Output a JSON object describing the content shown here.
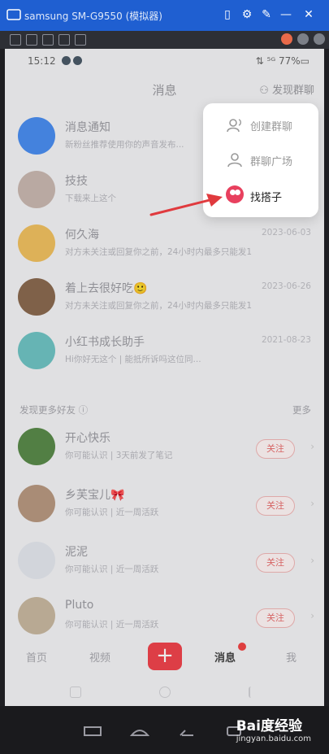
{
  "window": {
    "title": "samsung SM-G9550 (模拟器)",
    "minimize": "—",
    "close": "✕"
  },
  "status": {
    "time": "15:12",
    "right": "⇅ ⁵ᴳ 77%▭"
  },
  "header": {
    "title": "消息",
    "add_label": "发现群聊"
  },
  "popup": {
    "items": [
      {
        "label": "创建群聊",
        "icon": "group-icon"
      },
      {
        "label": "群聊广场",
        "icon": "square-icon"
      },
      {
        "label": "找搭子",
        "icon": "partner-bubble-icon"
      }
    ]
  },
  "conversations": [
    {
      "name": "消息通知",
      "sub": "新粉丝推荐使用你的声音发布...",
      "date": ""
    },
    {
      "name": "技技",
      "sub": "下载来上这个",
      "date": ""
    },
    {
      "name": "何久海",
      "sub": "对方未关注或回复你之前，24小时内最多只能发1条...",
      "date": "2023-06-03"
    },
    {
      "name": "着上去很好吃🙂",
      "sub": "对方未关注或回复你之前，24小时内最多只能发1条...",
      "date": "2023-06-26"
    },
    {
      "name": "小红书成长助手",
      "sub": "Hi你好无这个 | 能抵所诉吗这位同...",
      "date": "2021-08-23"
    }
  ],
  "section": {
    "title": "发现更多好友 ⓘ",
    "more": "更多"
  },
  "suggestions": [
    {
      "name": "开心快乐",
      "sub": "你可能认识 | 3天前发了笔记",
      "button": "关注"
    },
    {
      "name": "乡芙宝儿🎀",
      "sub": "你可能认识 | 近一周活跃",
      "button": "关注"
    },
    {
      "name": "泥泥",
      "sub": "你可能认识 | 近一周活跃",
      "button": "关注"
    },
    {
      "name": "Pluto",
      "sub": "你可能认识 | 近一周活跃",
      "button": "关注"
    }
  ],
  "bottom_nav": {
    "home": "首页",
    "video": "视频",
    "plus": "+",
    "messages": "消息",
    "me": "我"
  },
  "watermark": {
    "brand": "Bai度经验",
    "site": "jingyan.baidu.com"
  },
  "colors": {
    "accent": "#f0444c",
    "titlebar": "#1f5fd1",
    "arrow": "#e03a3e"
  }
}
